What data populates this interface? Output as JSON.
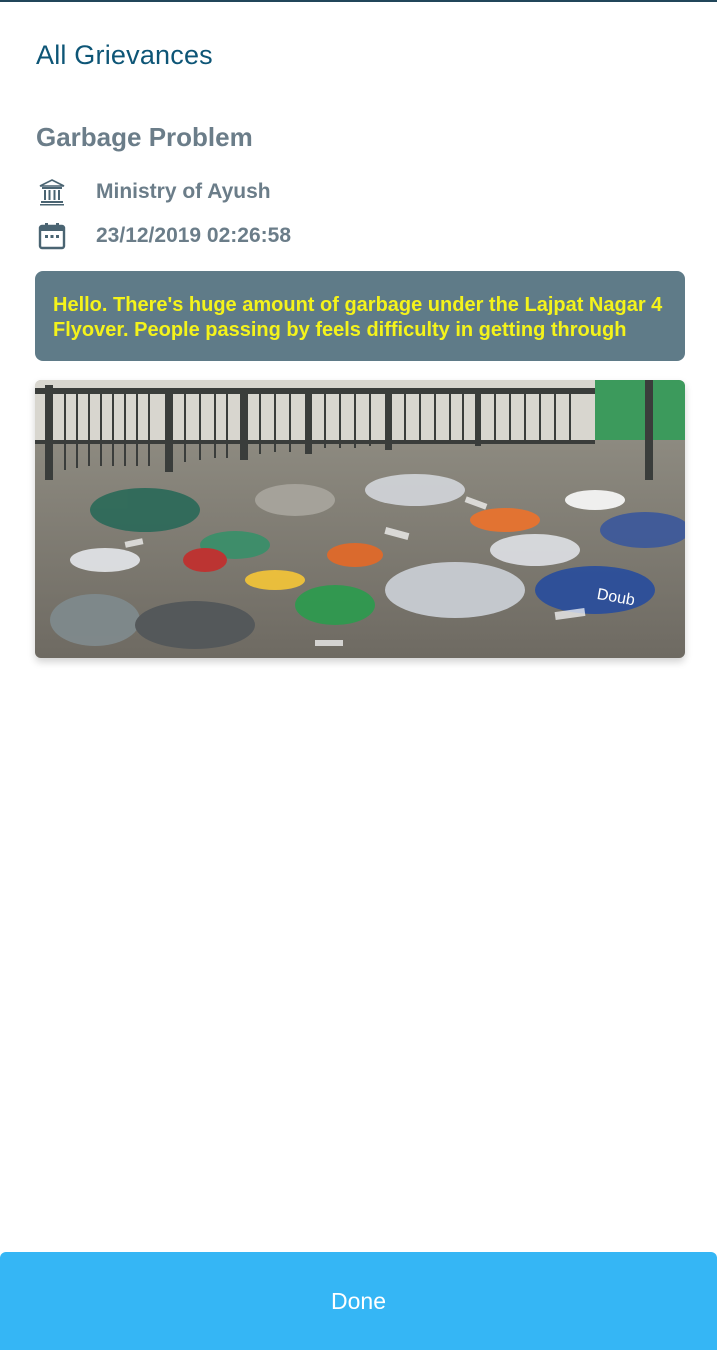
{
  "header": {
    "title": "All Grievances"
  },
  "grievance": {
    "title": "Garbage Problem",
    "ministry": "Ministry of Ayush",
    "ministry_icon": "government-building-icon",
    "date": "23/12/2019 02:26:58",
    "date_icon": "calendar-icon",
    "description": "Hello. There's huge amount of garbage under the Lajpat Nagar 4 Flyover. People passing by feels difficulty in getting through",
    "photo_text": "Doub"
  },
  "actions": {
    "done_label": "Done"
  },
  "colors": {
    "title_accent": "#0d5576",
    "muted_text": "#6b7d89",
    "message_background": "#5f7b88",
    "message_text": "#f4f31b",
    "done_button": "#35b6f5"
  }
}
